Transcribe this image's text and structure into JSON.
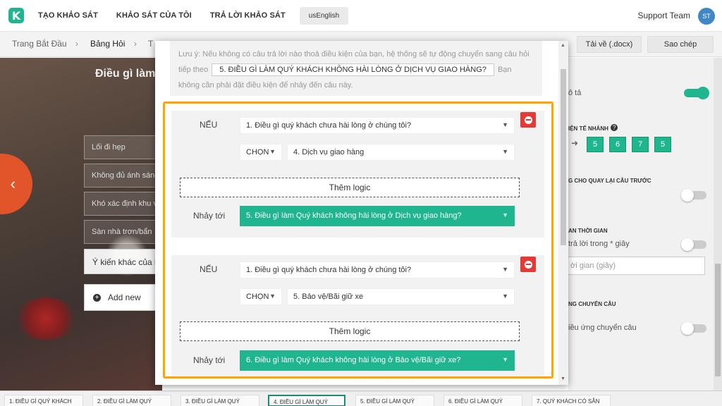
{
  "app": {
    "logo_letter": "K",
    "nav": [
      "TẠO KHẢO SÁT",
      "KHẢO SÁT CỦA TÔI",
      "TRẢ LỜI KHẢO SÁT"
    ],
    "language": "usEnglish",
    "support": "Support Team",
    "avatar": "ST"
  },
  "subbar": {
    "crumbs": [
      "Trang Bắt Đầu",
      "Bảng Hỏi",
      "T"
    ],
    "download": "Tải về (.docx)",
    "copy": "Sao chép"
  },
  "background": {
    "question_title": "Điều gì làm",
    "options": [
      "Lối đi hẹp",
      "Không đủ ánh sáng",
      "Khó xác định khu v",
      "Sàn nhà trơn/bẩn"
    ],
    "other_option": "Ý kiến khác của b",
    "add_new": "Add new",
    "prev_icon": "‹"
  },
  "right_panel": {
    "desc_label": "ô tả",
    "branch_label": "IỆN TẾ NHÁNH",
    "help_icon": "?",
    "branch_arrow": "➜",
    "branch_numbers": [
      "5",
      "6",
      "7",
      "5"
    ],
    "back_label": "G CHO QUAY LẠI CÂU TRƯỚC",
    "time_label": "AN THỜI GIAN",
    "time_desc": "trả lời trong * giây",
    "time_placeholder": "ời gian (giây)",
    "auto_next_label": "NG CHUYỂN CÂU",
    "auto_next_desc": "iều ứng chuyển câu"
  },
  "modal": {
    "note_prefix": "Lưu ý: Nếu không có câu trả lời nào thoả điều kiện của bạn, hệ thống sẽ tự động chuyển sang câu hỏi tiếp theo",
    "note_target": "5. ĐIỀU GÌ LÀM QUÝ KHÁCH KHÔNG HÀI LÒNG Ở DỊCH VỤ GIAO HÀNG?",
    "note_suffix": "Bạn không cần phải đặt điều kiện để nhảy đến câu này.",
    "rules": [
      {
        "if_label": "NẾU",
        "question": "1. Điều gì quý khách chưa hài lòng ở chúng tôi?",
        "operator": "CHỌN",
        "answer": "4. Dịch vụ giao hàng",
        "add_logic": "Thêm logic",
        "jump_label": "Nhảy tới",
        "jump_target": "5. Điều gì làm Quý khách không hài lòng ở Dịch vụ giao hàng?"
      },
      {
        "if_label": "NẾU",
        "question": "1. Điều gì quý khách chưa hài lòng ở chúng tôi?",
        "operator": "CHỌN",
        "answer": "5. Bảo vệ/Bãi giữ xe",
        "add_logic": "Thêm logic",
        "jump_label": "Nhảy tới",
        "jump_target": "6. Điều gì làm Quý khách không hài lòng ở Bảo vệ/Bãi giữ xe?"
      }
    ],
    "caret": "▼"
  },
  "bottom_tabs": [
    "1. ĐIỀU GÌ QUÝ KHÁCH",
    "2. ĐIỀU GÌ LÀM QUÝ",
    "3. ĐIỀU GÌ LÀM QUÝ",
    "4. ĐIỀU GÌ LÀM QUÝ",
    "5. ĐIỀU GÌ LÀM QUÝ",
    "6. ĐIỀU GÌ LÀM QUÝ",
    "7. QUÝ KHÁCH CÓ SẴN"
  ],
  "colors": {
    "accent_green": "#1fb58f",
    "highlight_orange": "#ffa502",
    "delete_red": "#e53935",
    "prev_orange": "#e2552a"
  }
}
